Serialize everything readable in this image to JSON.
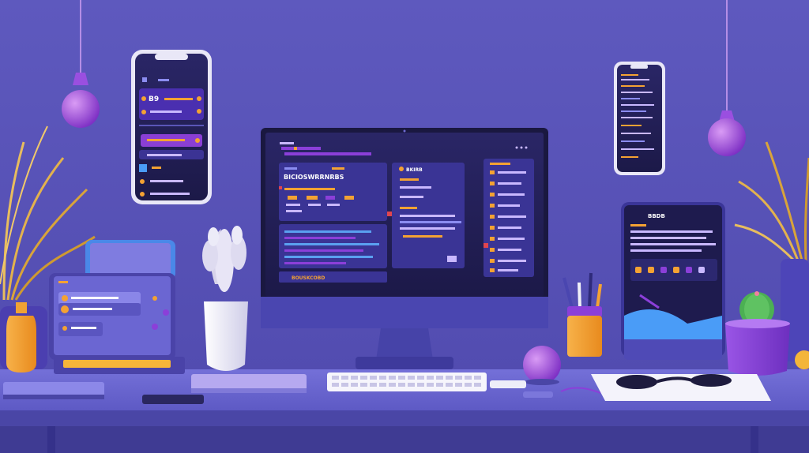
{
  "scene": {
    "title": "",
    "palette": {
      "wall": "#5a55b8",
      "desk": "#6b67cf",
      "accent_purple": "#8b3fd9",
      "accent_orange": "#f4a233",
      "screen_dark": "#1f1c52",
      "panel": "#3a3495"
    }
  },
  "monitor": {
    "title_text": "BICIOSWRRNRBS",
    "panel_label": "BKIRB",
    "footer_text": "BOUSKCOBD"
  },
  "left_phone": {
    "value_text": "B9"
  },
  "tablet": {
    "header_text": "BBDB"
  },
  "icons": {
    "monitor_dots": "ellipsis-icon",
    "phone_camera": "camera-icon",
    "keyboard": "keyboard-icon",
    "headphones": "headphones-icon"
  }
}
